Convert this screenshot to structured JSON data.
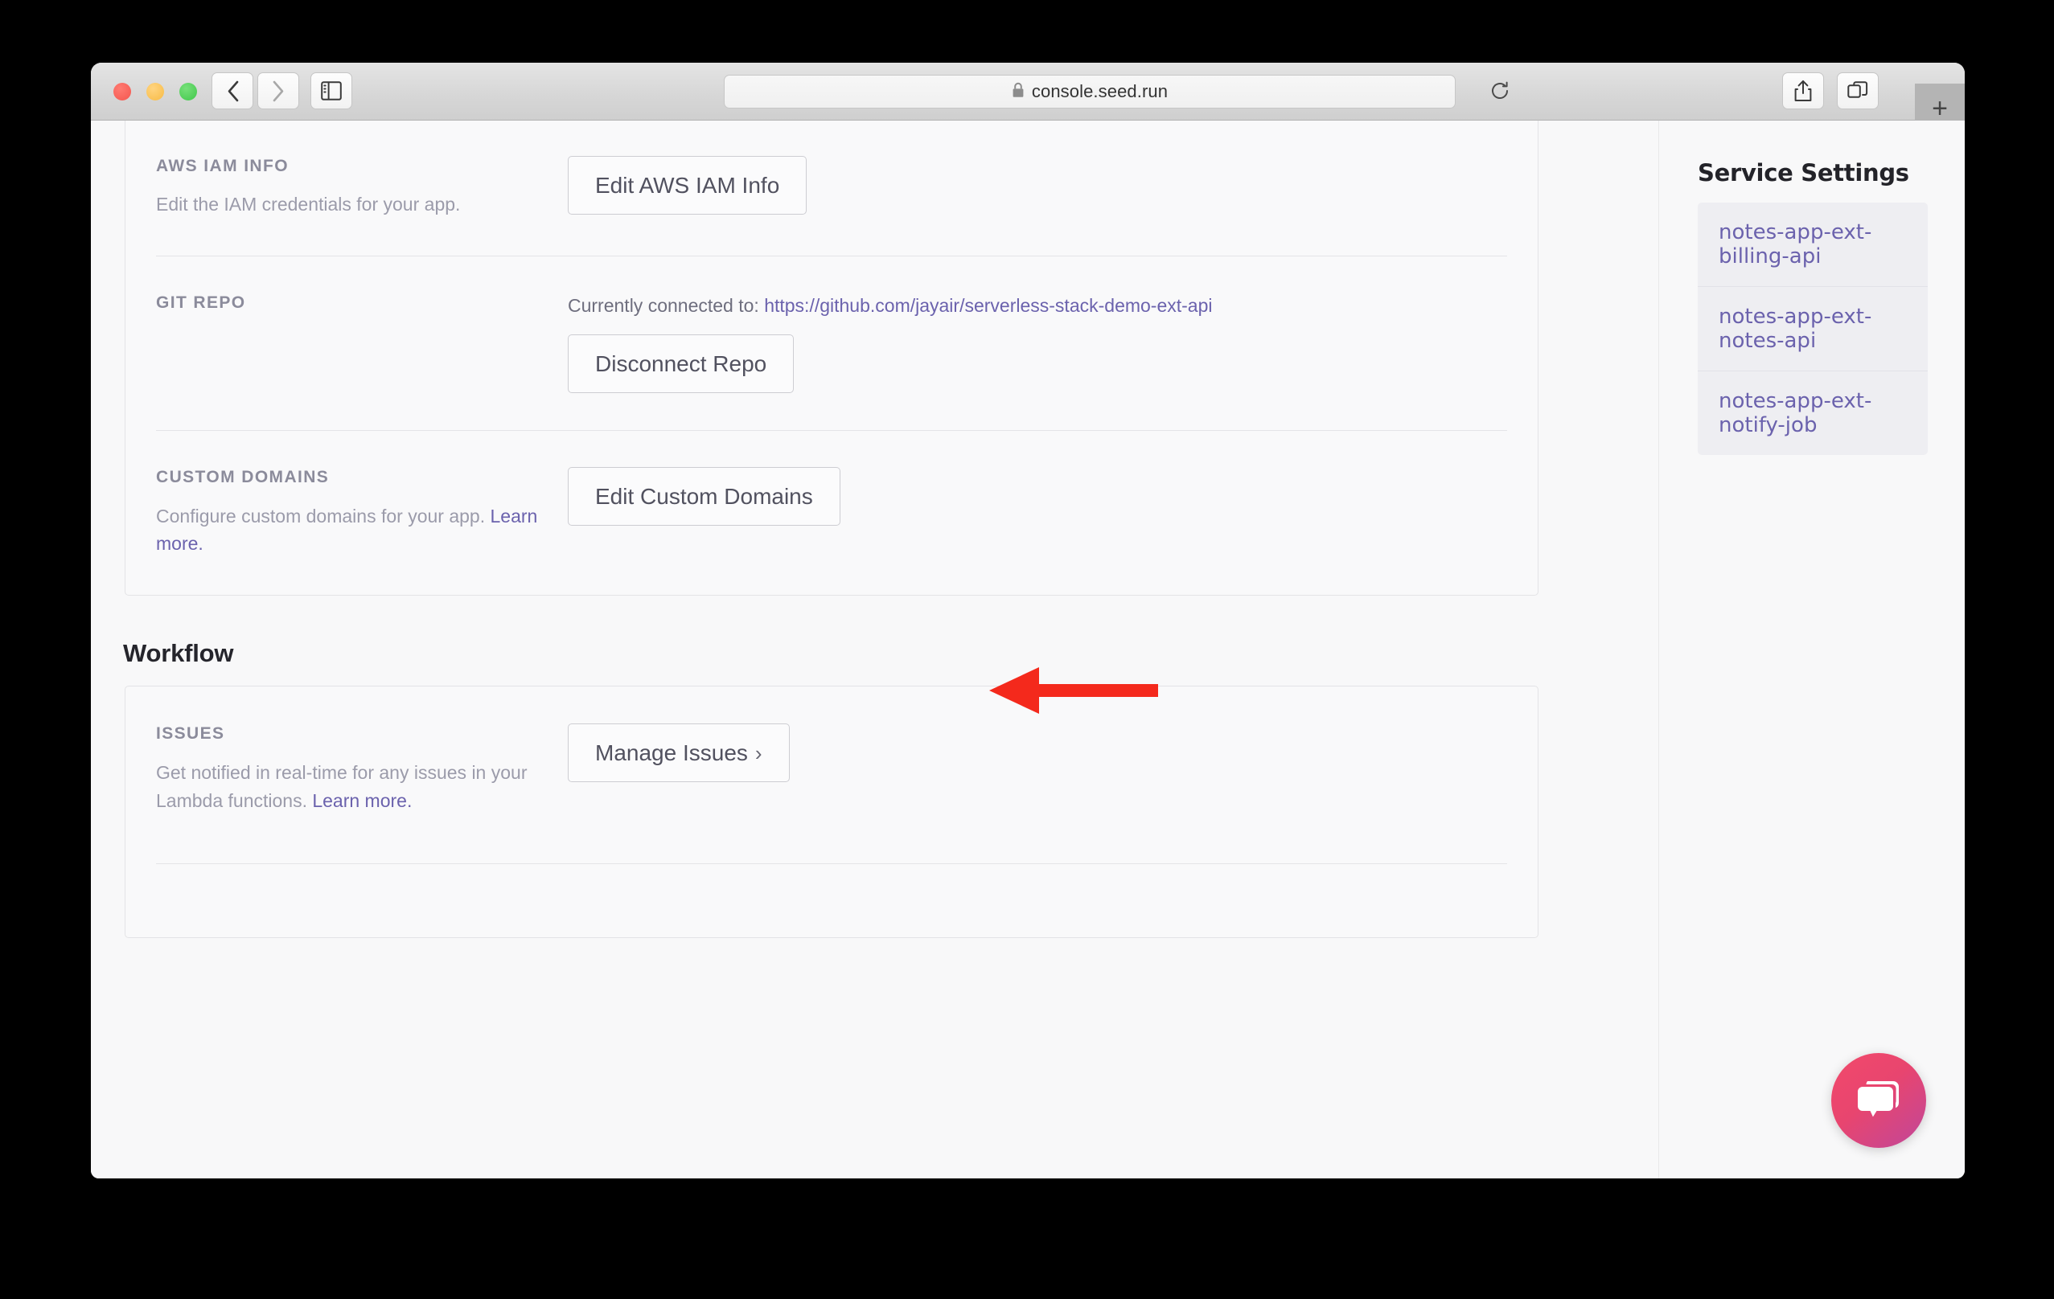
{
  "browser": {
    "url": "console.seed.run",
    "lock_icon": "lock-icon",
    "back_icon": "chevron-left-icon",
    "forward_icon": "chevron-right-icon",
    "sidebar_icon": "sidebar-toggle-icon",
    "reload_icon": "reload-icon",
    "share_icon": "share-icon",
    "tabs_icon": "tab-overview-icon",
    "new_tab_label": "+"
  },
  "app": {
    "sections": [
      {
        "key": "aws_iam_info",
        "label": "AWS IAM INFO",
        "description": "Edit the IAM credentials for your app.",
        "button": "Edit AWS IAM Info"
      },
      {
        "key": "git_repo",
        "label": "GIT REPO",
        "connected_prefix": "Currently connected to: ",
        "repo_url": "https://github.com/jayair/serverless-stack-demo-ext-api",
        "button": "Disconnect Repo"
      },
      {
        "key": "custom_domains",
        "label": "CUSTOM DOMAINS",
        "description": "Configure custom domains for your app. ",
        "learn_more": "Learn more.",
        "button": "Edit Custom Domains"
      }
    ],
    "workflow": {
      "title": "Workflow",
      "issues": {
        "label": "ISSUES",
        "description": "Get notified in real-time for any issues in your Lambda functions. ",
        "learn_more": "Learn more.",
        "button": "Manage Issues",
        "button_chevron": "›"
      }
    }
  },
  "sidebar": {
    "title": "Service Settings",
    "items": [
      {
        "label": "notes-app-ext-billing-api"
      },
      {
        "label": "notes-app-ext-notes-api"
      },
      {
        "label": "notes-app-ext-notify-job"
      }
    ]
  },
  "annotation": {
    "arrow_icon": "left-arrow-annotation",
    "arrow_color": "#F4291C"
  },
  "chat": {
    "icon": "chat-bubble-icon",
    "gradient_from": "#F2496B",
    "gradient_to": "#C0479A"
  }
}
